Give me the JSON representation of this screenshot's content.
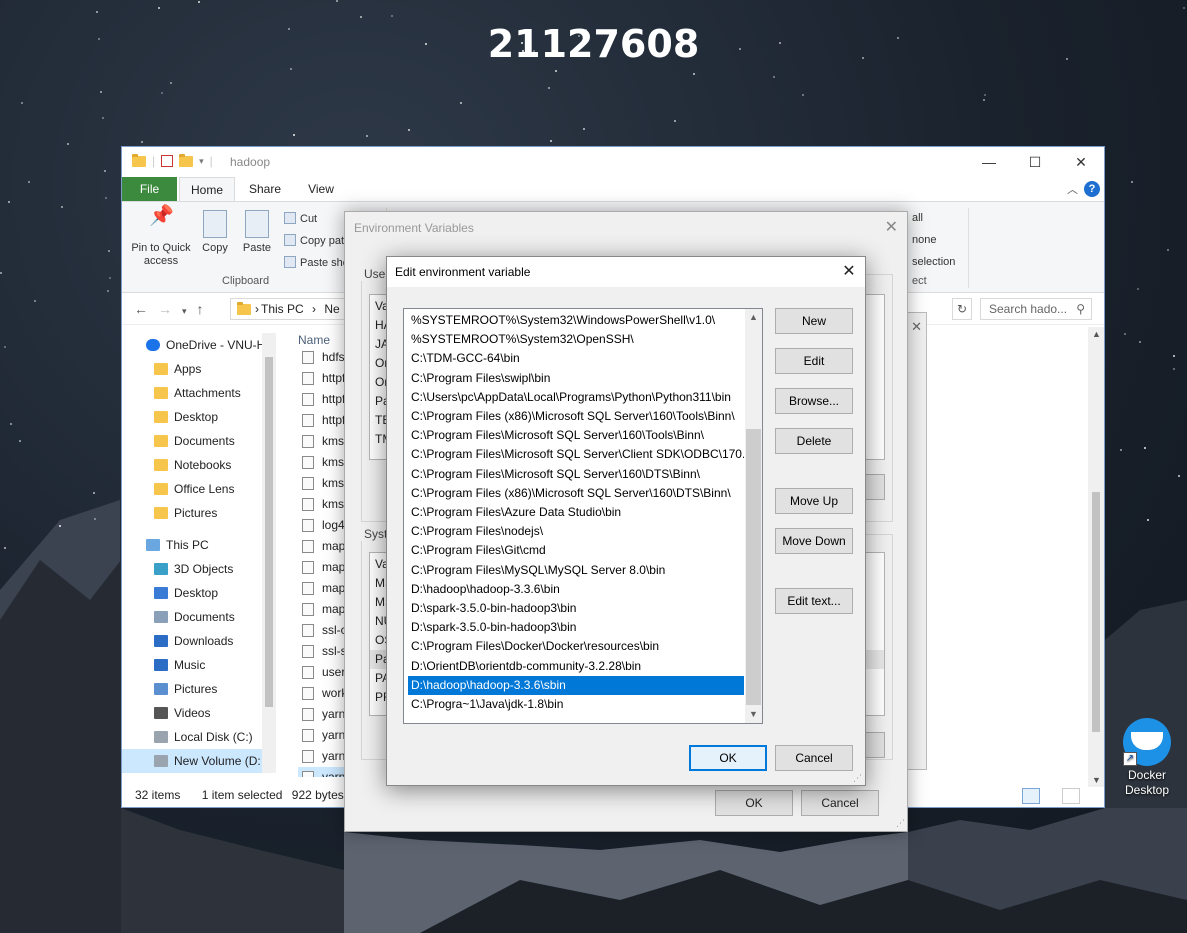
{
  "overlay": {
    "student_id": "21127608"
  },
  "desktop": {
    "docker_label_1": "Docker",
    "docker_label_2": "Desktop"
  },
  "explorer": {
    "title": "hadoop",
    "tabs": {
      "file": "File",
      "home": "Home",
      "share": "Share",
      "view": "View"
    },
    "ribbon": {
      "pin_label_1": "Pin to Quick",
      "pin_label_2": "access",
      "copy": "Copy",
      "paste": "Paste",
      "cut": "Cut",
      "copy_path": "Copy pat",
      "paste_shortcut": "Paste sho",
      "clipboard": "Clipboard",
      "select_all": "all",
      "select_none": "none",
      "invert_selection": "selection",
      "select_group": "ect"
    },
    "address": {
      "this_pc": "This PC",
      "segment": "Ne",
      "search_placeholder": "Search hado..."
    },
    "column_name": "Name",
    "nav": [
      {
        "label": "OneDrive - VNU-H",
        "icon": "cloud-icon"
      },
      {
        "label": "Apps",
        "icon": "folder-icon"
      },
      {
        "label": "Attachments",
        "icon": "folder-icon"
      },
      {
        "label": "Desktop",
        "icon": "folder-icon"
      },
      {
        "label": "Documents",
        "icon": "folder-icon"
      },
      {
        "label": "Notebooks",
        "icon": "folder-icon"
      },
      {
        "label": "Office Lens",
        "icon": "folder-icon"
      },
      {
        "label": "Pictures",
        "icon": "folder-icon"
      },
      {
        "label": "This PC",
        "icon": "computer-icon"
      },
      {
        "label": "3D Objects",
        "icon": "cube-icon"
      },
      {
        "label": "Desktop",
        "icon": "desktop-icon"
      },
      {
        "label": "Documents",
        "icon": "documents-icon"
      },
      {
        "label": "Downloads",
        "icon": "download-icon"
      },
      {
        "label": "Music",
        "icon": "music-icon"
      },
      {
        "label": "Pictures",
        "icon": "pictures-icon"
      },
      {
        "label": "Videos",
        "icon": "video-icon"
      },
      {
        "label": "Local Disk (C:)",
        "icon": "disk-icon"
      },
      {
        "label": "New Volume (D:",
        "icon": "disk-icon"
      }
    ],
    "files": [
      "hdfs-",
      "httpf",
      "httpf",
      "httpf",
      "kms-",
      "kms-",
      "kms-",
      "kms-",
      "log4j",
      "mapr",
      "mapr",
      "mapr",
      "mapr",
      "ssl-cl",
      "ssl-se",
      "user_",
      "work",
      "yarn-",
      "yarn-",
      "yarns",
      "yarn-"
    ],
    "status": {
      "count": "32 items",
      "selected": "1 item selected",
      "size": "922 bytes"
    }
  },
  "env_dialog": {
    "title": "Environment Variables",
    "user_group": "User",
    "system_group": "Syste",
    "user_rows": [
      "Va",
      "HA",
      "JAV",
      "On",
      "On",
      "Pat",
      "TE",
      "TM"
    ],
    "system_rows": [
      "Va",
      "MS",
      "MS",
      "NU",
      "OS",
      "Pat",
      "PA",
      "PR"
    ],
    "ok": "OK",
    "cancel": "Cancel"
  },
  "edit_dialog": {
    "title": "Edit environment variable",
    "paths": [
      "%SYSTEMROOT%\\System32\\WindowsPowerShell\\v1.0\\",
      "%SYSTEMROOT%\\System32\\OpenSSH\\",
      "C:\\TDM-GCC-64\\bin",
      "C:\\Program Files\\swipl\\bin",
      "C:\\Users\\pc\\AppData\\Local\\Programs\\Python\\Python311\\bin",
      "C:\\Program Files (x86)\\Microsoft SQL Server\\160\\Tools\\Binn\\",
      "C:\\Program Files\\Microsoft SQL Server\\160\\Tools\\Binn\\",
      "C:\\Program Files\\Microsoft SQL Server\\Client SDK\\ODBC\\170...",
      "C:\\Program Files\\Microsoft SQL Server\\160\\DTS\\Binn\\",
      "C:\\Program Files (x86)\\Microsoft SQL Server\\160\\DTS\\Binn\\",
      "C:\\Program Files\\Azure Data Studio\\bin",
      "C:\\Program Files\\nodejs\\",
      "C:\\Program Files\\Git\\cmd",
      "C:\\Program Files\\MySQL\\MySQL Server 8.0\\bin",
      "D:\\hadoop\\hadoop-3.3.6\\bin",
      "D:\\spark-3.5.0-bin-hadoop3\\bin",
      "D:\\spark-3.5.0-bin-hadoop3\\bin",
      "C:\\Program Files\\Docker\\Docker\\resources\\bin",
      "D:\\OrientDB\\orientdb-community-3.2.28\\bin",
      "D:\\hadoop\\hadoop-3.3.6\\sbin",
      "C:\\Progra~1\\Java\\jdk-1.8\\bin"
    ],
    "selected_index": 19,
    "buttons": {
      "new": "New",
      "edit": "Edit",
      "browse": "Browse...",
      "delete": "Delete",
      "move_up": "Move Up",
      "move_down": "Move Down",
      "edit_text": "Edit text...",
      "ok": "OK",
      "cancel": "Cancel"
    },
    "accent": "#0078d7"
  }
}
